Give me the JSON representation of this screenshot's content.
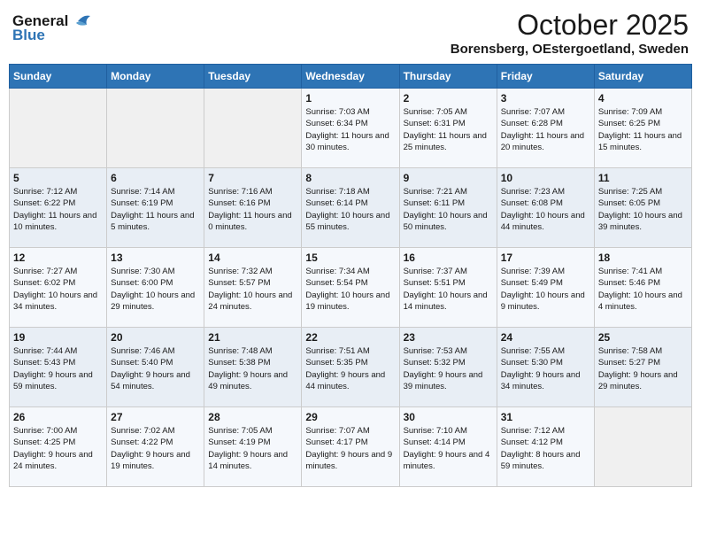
{
  "header": {
    "logo_general": "General",
    "logo_blue": "Blue",
    "month": "October 2025",
    "location": "Borensberg, OEstergoetland, Sweden"
  },
  "weekdays": [
    "Sunday",
    "Monday",
    "Tuesday",
    "Wednesday",
    "Thursday",
    "Friday",
    "Saturday"
  ],
  "weeks": [
    [
      {
        "day": "",
        "sunrise": "",
        "sunset": "",
        "daylight": "",
        "empty": true
      },
      {
        "day": "",
        "sunrise": "",
        "sunset": "",
        "daylight": "",
        "empty": true
      },
      {
        "day": "",
        "sunrise": "",
        "sunset": "",
        "daylight": "",
        "empty": true
      },
      {
        "day": "1",
        "sunrise": "Sunrise: 7:03 AM",
        "sunset": "Sunset: 6:34 PM",
        "daylight": "Daylight: 11 hours and 30 minutes."
      },
      {
        "day": "2",
        "sunrise": "Sunrise: 7:05 AM",
        "sunset": "Sunset: 6:31 PM",
        "daylight": "Daylight: 11 hours and 25 minutes."
      },
      {
        "day": "3",
        "sunrise": "Sunrise: 7:07 AM",
        "sunset": "Sunset: 6:28 PM",
        "daylight": "Daylight: 11 hours and 20 minutes."
      },
      {
        "day": "4",
        "sunrise": "Sunrise: 7:09 AM",
        "sunset": "Sunset: 6:25 PM",
        "daylight": "Daylight: 11 hours and 15 minutes."
      }
    ],
    [
      {
        "day": "5",
        "sunrise": "Sunrise: 7:12 AM",
        "sunset": "Sunset: 6:22 PM",
        "daylight": "Daylight: 11 hours and 10 minutes."
      },
      {
        "day": "6",
        "sunrise": "Sunrise: 7:14 AM",
        "sunset": "Sunset: 6:19 PM",
        "daylight": "Daylight: 11 hours and 5 minutes."
      },
      {
        "day": "7",
        "sunrise": "Sunrise: 7:16 AM",
        "sunset": "Sunset: 6:16 PM",
        "daylight": "Daylight: 11 hours and 0 minutes."
      },
      {
        "day": "8",
        "sunrise": "Sunrise: 7:18 AM",
        "sunset": "Sunset: 6:14 PM",
        "daylight": "Daylight: 10 hours and 55 minutes."
      },
      {
        "day": "9",
        "sunrise": "Sunrise: 7:21 AM",
        "sunset": "Sunset: 6:11 PM",
        "daylight": "Daylight: 10 hours and 50 minutes."
      },
      {
        "day": "10",
        "sunrise": "Sunrise: 7:23 AM",
        "sunset": "Sunset: 6:08 PM",
        "daylight": "Daylight: 10 hours and 44 minutes."
      },
      {
        "day": "11",
        "sunrise": "Sunrise: 7:25 AM",
        "sunset": "Sunset: 6:05 PM",
        "daylight": "Daylight: 10 hours and 39 minutes."
      }
    ],
    [
      {
        "day": "12",
        "sunrise": "Sunrise: 7:27 AM",
        "sunset": "Sunset: 6:02 PM",
        "daylight": "Daylight: 10 hours and 34 minutes."
      },
      {
        "day": "13",
        "sunrise": "Sunrise: 7:30 AM",
        "sunset": "Sunset: 6:00 PM",
        "daylight": "Daylight: 10 hours and 29 minutes."
      },
      {
        "day": "14",
        "sunrise": "Sunrise: 7:32 AM",
        "sunset": "Sunset: 5:57 PM",
        "daylight": "Daylight: 10 hours and 24 minutes."
      },
      {
        "day": "15",
        "sunrise": "Sunrise: 7:34 AM",
        "sunset": "Sunset: 5:54 PM",
        "daylight": "Daylight: 10 hours and 19 minutes."
      },
      {
        "day": "16",
        "sunrise": "Sunrise: 7:37 AM",
        "sunset": "Sunset: 5:51 PM",
        "daylight": "Daylight: 10 hours and 14 minutes."
      },
      {
        "day": "17",
        "sunrise": "Sunrise: 7:39 AM",
        "sunset": "Sunset: 5:49 PM",
        "daylight": "Daylight: 10 hours and 9 minutes."
      },
      {
        "day": "18",
        "sunrise": "Sunrise: 7:41 AM",
        "sunset": "Sunset: 5:46 PM",
        "daylight": "Daylight: 10 hours and 4 minutes."
      }
    ],
    [
      {
        "day": "19",
        "sunrise": "Sunrise: 7:44 AM",
        "sunset": "Sunset: 5:43 PM",
        "daylight": "Daylight: 9 hours and 59 minutes."
      },
      {
        "day": "20",
        "sunrise": "Sunrise: 7:46 AM",
        "sunset": "Sunset: 5:40 PM",
        "daylight": "Daylight: 9 hours and 54 minutes."
      },
      {
        "day": "21",
        "sunrise": "Sunrise: 7:48 AM",
        "sunset": "Sunset: 5:38 PM",
        "daylight": "Daylight: 9 hours and 49 minutes."
      },
      {
        "day": "22",
        "sunrise": "Sunrise: 7:51 AM",
        "sunset": "Sunset: 5:35 PM",
        "daylight": "Daylight: 9 hours and 44 minutes."
      },
      {
        "day": "23",
        "sunrise": "Sunrise: 7:53 AM",
        "sunset": "Sunset: 5:32 PM",
        "daylight": "Daylight: 9 hours and 39 minutes."
      },
      {
        "day": "24",
        "sunrise": "Sunrise: 7:55 AM",
        "sunset": "Sunset: 5:30 PM",
        "daylight": "Daylight: 9 hours and 34 minutes."
      },
      {
        "day": "25",
        "sunrise": "Sunrise: 7:58 AM",
        "sunset": "Sunset: 5:27 PM",
        "daylight": "Daylight: 9 hours and 29 minutes."
      }
    ],
    [
      {
        "day": "26",
        "sunrise": "Sunrise: 7:00 AM",
        "sunset": "Sunset: 4:25 PM",
        "daylight": "Daylight: 9 hours and 24 minutes."
      },
      {
        "day": "27",
        "sunrise": "Sunrise: 7:02 AM",
        "sunset": "Sunset: 4:22 PM",
        "daylight": "Daylight: 9 hours and 19 minutes."
      },
      {
        "day": "28",
        "sunrise": "Sunrise: 7:05 AM",
        "sunset": "Sunset: 4:19 PM",
        "daylight": "Daylight: 9 hours and 14 minutes."
      },
      {
        "day": "29",
        "sunrise": "Sunrise: 7:07 AM",
        "sunset": "Sunset: 4:17 PM",
        "daylight": "Daylight: 9 hours and 9 minutes."
      },
      {
        "day": "30",
        "sunrise": "Sunrise: 7:10 AM",
        "sunset": "Sunset: 4:14 PM",
        "daylight": "Daylight: 9 hours and 4 minutes."
      },
      {
        "day": "31",
        "sunrise": "Sunrise: 7:12 AM",
        "sunset": "Sunset: 4:12 PM",
        "daylight": "Daylight: 8 hours and 59 minutes."
      },
      {
        "day": "",
        "sunrise": "",
        "sunset": "",
        "daylight": "",
        "empty": true
      }
    ]
  ]
}
